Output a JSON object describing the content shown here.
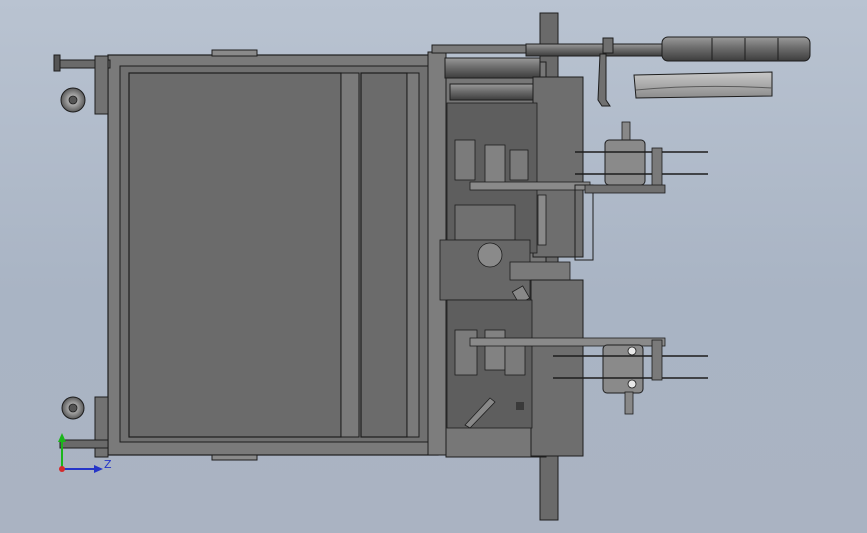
{
  "viewport": {
    "background_top": "#b9c3d1",
    "background_bottom": "#aab3c2"
  },
  "model": {
    "metal_fill": "#7a7a7a",
    "metal_dark": "#4a4a4a",
    "edge": "#1d1d1d",
    "panel_fill": "#6b6b6b"
  },
  "triad": {
    "y_color": "#1bb51b",
    "z_color": "#2535c8",
    "z_label": "Z"
  }
}
